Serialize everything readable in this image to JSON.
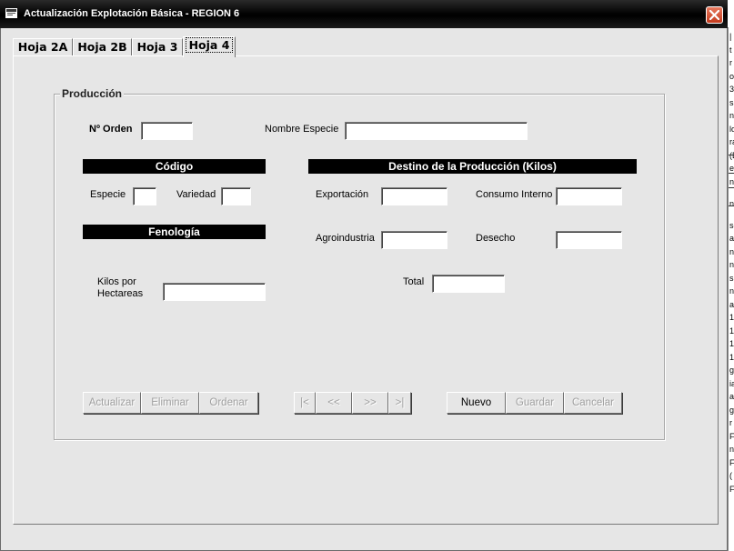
{
  "window": {
    "title": "Actualización Explotación Básica - REGION 6"
  },
  "tabs": [
    {
      "label": "Hoja 2A",
      "active": false
    },
    {
      "label": "Hoja 2B",
      "active": false
    },
    {
      "label": "Hoja 3",
      "active": false
    },
    {
      "label": "Hoja 4",
      "active": true
    }
  ],
  "form": {
    "group_title": "Producción",
    "orden_label": "Nº Orden",
    "orden_value": "",
    "nombre_especie_label": "Nombre Especie",
    "nombre_especie_value": "",
    "codigo_header": "Código",
    "especie_label": "Especie",
    "especie_value": "",
    "variedad_label": "Variedad",
    "variedad_value": "",
    "fenologia_header": "Fenología",
    "kilos_label_line1": "Kilos por",
    "kilos_label_line2": "Hectareas",
    "kilos_value": "",
    "destino_header": "Destino de la Producción  (Kilos)",
    "exportacion_label": "Exportación",
    "exportacion_value": "",
    "consumo_label": "Consumo Interno",
    "consumo_value": "",
    "agroindustria_label": "Agroindustria",
    "agroindustria_value": "",
    "desecho_label": "Desecho",
    "desecho_value": "",
    "total_label": "Total",
    "total_value": ""
  },
  "buttons": {
    "actualizar": "Actualizar",
    "eliminar": "Eliminar",
    "ordenar": "Ordenar",
    "first": "|<",
    "prev": "<<",
    "next": ">>",
    "last": ">|",
    "nuevo": "Nuevo",
    "guardar": "Guardar",
    "cancelar": "Cancelar"
  },
  "background": {
    "fragments": [
      "|",
      "t",
      "r",
      "o",
      "3",
      "s",
      "n",
      "lo",
      "ra",
      "(E",
      "e",
      "n",
      "n",
      "so",
      "a",
      "n",
      "n",
      "s",
      "n",
      "a",
      "1",
      "1",
      "1",
      "1",
      "g",
      "ia",
      "a",
      "g",
      "r",
      "F",
      "n",
      "F",
      "(",
      "F"
    ]
  },
  "colors": {
    "window_bg": "#e6e6e6",
    "titlebar": "#000000",
    "close_button": "#d4502f",
    "header_bar": "#000000",
    "disabled_text": "#a0a0a0"
  },
  "icons": [
    "window-app-icon",
    "close-icon"
  ]
}
